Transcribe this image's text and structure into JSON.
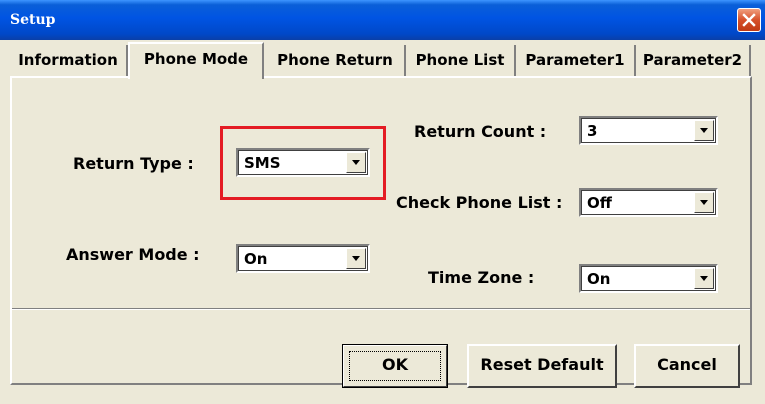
{
  "window": {
    "title": "Setup"
  },
  "tabs": [
    {
      "label": "Information"
    },
    {
      "label": "Phone Mode"
    },
    {
      "label": "Phone Return"
    },
    {
      "label": "Phone List"
    },
    {
      "label": "Parameter1"
    },
    {
      "label": "Parameter2"
    }
  ],
  "active_tab": "Phone Mode",
  "form": {
    "return_type": {
      "label": "Return Type :",
      "value": "SMS"
    },
    "answer_mode": {
      "label": "Answer Mode :",
      "value": "On"
    },
    "return_count": {
      "label": "Return Count :",
      "value": "3"
    },
    "check_phone_list": {
      "label": "Check Phone List :",
      "value": "Off"
    },
    "time_zone": {
      "label": "Time Zone :",
      "value": "On"
    }
  },
  "buttons": {
    "ok": "OK",
    "reset_default": "Reset Default",
    "cancel": "Cancel"
  },
  "colors": {
    "titlebar": "#0054e3",
    "close_button": "#d6502a",
    "highlight_box": "#e41c24",
    "dialog_background": "#ece9d8"
  },
  "icons": {
    "close": "close-icon",
    "dropdown": "chevron-down-icon"
  }
}
